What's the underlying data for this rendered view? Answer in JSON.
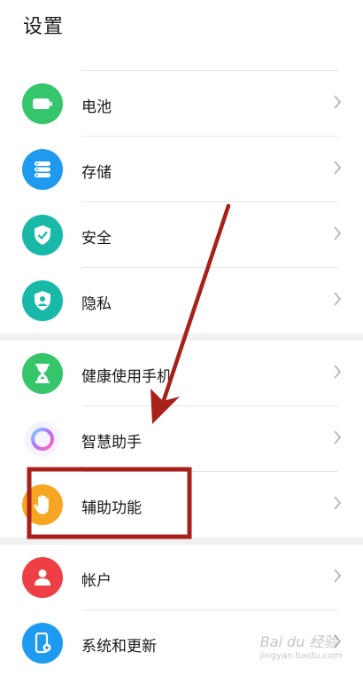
{
  "header": {
    "title": "设置"
  },
  "colors": {
    "orange": "#f6a623",
    "green": "#35c56b",
    "blue": "#1e9bf0",
    "teal": "#18b9a8",
    "red": "#ee3f46",
    "annotation_red": "#a8201a"
  },
  "settings": {
    "items": [
      {
        "label": "电池",
        "icon": "battery-icon"
      },
      {
        "label": "存储",
        "icon": "storage-icon"
      },
      {
        "label": "安全",
        "icon": "security-shield-icon"
      },
      {
        "label": "隐私",
        "icon": "privacy-icon"
      },
      {
        "label": "健康使用手机",
        "icon": "hourglass-icon"
      },
      {
        "label": "智慧助手",
        "icon": "smart-assistant-icon"
      },
      {
        "label": "辅助功能",
        "icon": "hand-icon"
      },
      {
        "label": "帐户",
        "icon": "account-icon"
      },
      {
        "label": "系统和更新",
        "icon": "system-update-icon"
      }
    ]
  },
  "watermark": {
    "text": "Bai du 经验",
    "sub": "jingyan.baidu.com"
  }
}
